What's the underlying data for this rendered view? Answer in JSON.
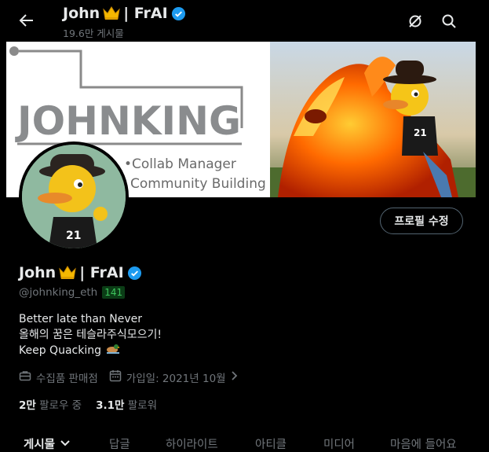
{
  "header": {
    "name": "John",
    "name_suffix": "| FrAI",
    "posts_count": "19.6만 게시물"
  },
  "banner": {
    "logo_text": "JOHNKING",
    "tagline_1": "•Collab Manager",
    "tagline_2": "Community Building"
  },
  "profile": {
    "edit_label": "프로필 수정",
    "name": "John",
    "name_suffix": "| FrAI",
    "handle": "@johnking_eth",
    "handle_badge": "141",
    "bio_line1": "Better late than Never",
    "bio_line2": "올해의 꿈은 테슬라주식모으기!",
    "bio_line3": "Keep Quacking",
    "category": "수집품 판매점",
    "joined": "가입일: 2021년 10월",
    "following_count": "2만",
    "following_label": "팔로우 중",
    "followers_count": "3.1만",
    "followers_label": "팔로워"
  },
  "tabs": [
    "게시물",
    "답글",
    "하이라이트",
    "아티클",
    "미디어",
    "마음에 들어요"
  ],
  "colors": {
    "verified": "#1d9bf0",
    "badge_bg": "#0b3d16",
    "badge_fg": "#3ec45d"
  }
}
